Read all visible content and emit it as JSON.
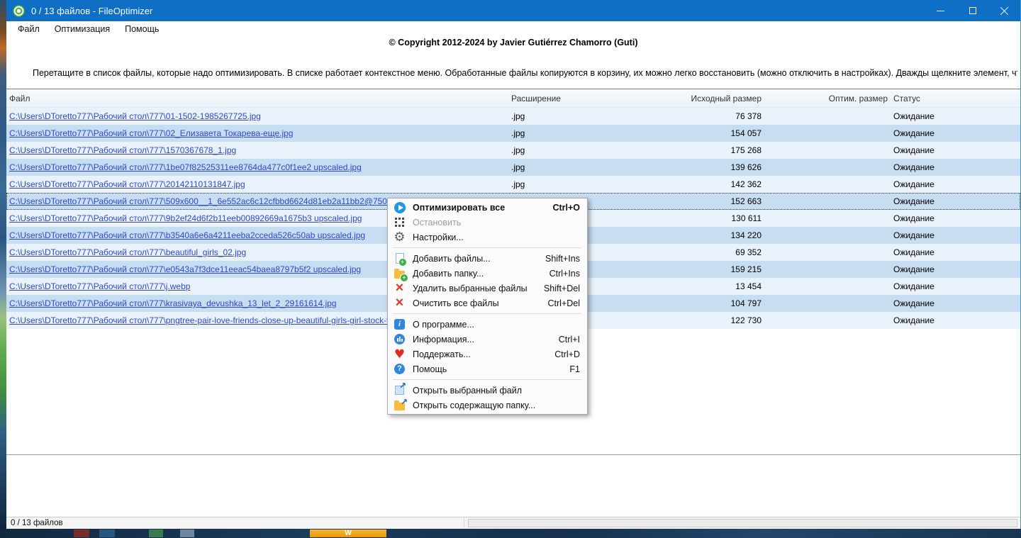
{
  "window": {
    "title": "0 / 13 файлов - FileOptimizer"
  },
  "menubar": {
    "items": [
      "Файл",
      "Оптимизация",
      "Помощь"
    ]
  },
  "intro": {
    "copyright": "© Copyright 2012-2024 by Javier Gutiérrez Chamorro (Guti)",
    "instruction": "Перетащите в список файлы, которые надо оптимизировать. В списке работает контекстное меню. Обработанные файлы копируются в корзину, их можно легко восстановить (можно отключить в настройках). Дважды щелкните элемент, чтобы просмотреть его."
  },
  "table": {
    "columns": [
      "Файл",
      "Расширение",
      "Исходный размер",
      "Оптим. размер",
      "Статус"
    ],
    "rows": [
      {
        "path": "C:\\Users\\DToretto777\\Рабочий стол\\777\\01-1502-1985267725.jpg",
        "ext": ".jpg",
        "size": "76 378",
        "optimized": "",
        "status": "Ожидание",
        "selected": false
      },
      {
        "path": "C:\\Users\\DToretto777\\Рабочий стол\\777\\02_Елизавета Токарева-еще.jpg",
        "ext": ".jpg",
        "size": "154 057",
        "optimized": "",
        "status": "Ожидание",
        "selected": false
      },
      {
        "path": "C:\\Users\\DToretto777\\Рабочий стол\\777\\1570367678_1.jpg",
        "ext": ".jpg",
        "size": "175 268",
        "optimized": "",
        "status": "Ожидание",
        "selected": false
      },
      {
        "path": "C:\\Users\\DToretto777\\Рабочий стол\\777\\1be07f82525311ee8764da477c0f1ee2 upscaled.jpg",
        "ext": ".jpg",
        "size": "139 626",
        "optimized": "",
        "status": "Ожидание",
        "selected": false
      },
      {
        "path": "C:\\Users\\DToretto777\\Рабочий стол\\777\\20142110131847.jpg",
        "ext": ".jpg",
        "size": "142 362",
        "optimized": "",
        "status": "Ожидание",
        "selected": false
      },
      {
        "path": "C:\\Users\\DToretto777\\Рабочий стол\\777\\509x600__1_6e552ac6c12cfbbd6624d81eb2a11bb2@750x884_0xac",
        "ext": ".jpg",
        "size": "152 663",
        "optimized": "",
        "status": "Ожидание",
        "selected": true
      },
      {
        "path": "C:\\Users\\DToretto777\\Рабочий стол\\777\\9b2ef24d6f2b11eeb00892669a1675b3 upscaled.jpg",
        "ext": ".jpg",
        "size": "130 611",
        "optimized": "",
        "status": "Ожидание",
        "selected": false
      },
      {
        "path": "C:\\Users\\DToretto777\\Рабочий стол\\777\\b3540a6e6a4211eeba2cceda526c50ab upscaled.jpg",
        "ext": ".jpg",
        "size": "134 220",
        "optimized": "",
        "status": "Ожидание",
        "selected": false
      },
      {
        "path": "C:\\Users\\DToretto777\\Рабочий стол\\777\\beautiful_girls_02.jpg",
        "ext": ".jpg",
        "size": "69 352",
        "optimized": "",
        "status": "Ожидание",
        "selected": false
      },
      {
        "path": "C:\\Users\\DToretto777\\Рабочий стол\\777\\e0543a7f3dce11eeac54baea8797b5f2 upscaled.jpg",
        "ext": ".jpg",
        "size": "159 215",
        "optimized": "",
        "status": "Ожидание",
        "selected": false
      },
      {
        "path": "C:\\Users\\DToretto777\\Рабочий стол\\777\\j.webp",
        "ext": ".webp",
        "size": "13 454",
        "optimized": "",
        "status": "Ожидание",
        "selected": false
      },
      {
        "path": "C:\\Users\\DToretto777\\Рабочий стол\\777\\krasivaya_devushka_13_let_2_29161614.jpg",
        "ext": ".jpg",
        "size": "104 797",
        "optimized": "",
        "status": "Ожидание",
        "selected": false
      },
      {
        "path": "C:\\Users\\DToretto777\\Рабочий стол\\777\\pngtree-pair-love-friends-close-up-beautiful-girls-girl-stock-videos-im",
        "ext": ".jpg",
        "size": "122 730",
        "optimized": "",
        "status": "Ожидание",
        "selected": false
      }
    ]
  },
  "context_menu": {
    "items": [
      {
        "label": "Оптимизировать все",
        "shortcut": "Ctrl+O",
        "icon": "optimize-play-icon",
        "bold": true
      },
      {
        "label": "Остановить",
        "shortcut": "",
        "icon": "stop-icon",
        "disabled": true
      },
      {
        "label": "Настройки...",
        "shortcut": "",
        "icon": "settings-gear-icon"
      },
      {
        "type": "separator"
      },
      {
        "label": "Добавить файлы...",
        "shortcut": "Shift+Ins",
        "icon": "add-files-icon"
      },
      {
        "label": "Добавить папку...",
        "shortcut": "Ctrl+Ins",
        "icon": "add-folder-icon"
      },
      {
        "label": "Удалить выбранные файлы",
        "shortcut": "Shift+Del",
        "icon": "delete-selected-icon"
      },
      {
        "label": "Очистить все файлы",
        "shortcut": "Ctrl+Del",
        "icon": "clear-all-icon"
      },
      {
        "type": "separator"
      },
      {
        "label": "О программе...",
        "shortcut": "",
        "icon": "about-icon"
      },
      {
        "label": "Информация...",
        "shortcut": "Ctrl+I",
        "icon": "information-icon"
      },
      {
        "label": "Поддержать...",
        "shortcut": "Ctrl+D",
        "icon": "donate-heart-icon"
      },
      {
        "label": "Помощь",
        "shortcut": "F1",
        "icon": "help-icon"
      },
      {
        "type": "separator"
      },
      {
        "label": "Открыть выбранный файл",
        "shortcut": "",
        "icon": "open-file-icon"
      },
      {
        "label": "Открыть содержащую папку...",
        "shortcut": "",
        "icon": "open-folder-icon"
      }
    ]
  },
  "statusbar": {
    "text": "0 / 13 файлов",
    "progress_percent": 0
  },
  "desktop": {
    "taskbar_w_icon_label": "W"
  },
  "colors": {
    "titlebar": "#0e6fc4",
    "row_light": "#e9f2fa",
    "row_dark": "#c7ddf1",
    "link": "#3348c8",
    "accent_blue": "#2196e8",
    "status_red": "#e03a2f"
  }
}
